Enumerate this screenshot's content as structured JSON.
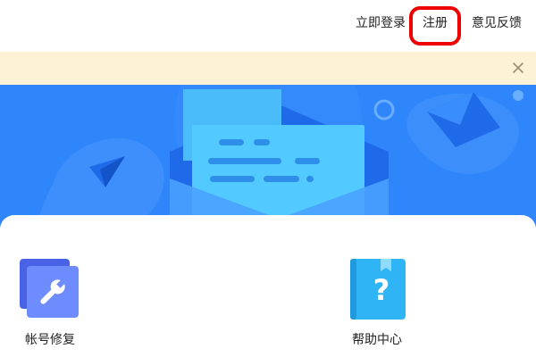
{
  "topbar": {
    "login_label": "立即登录",
    "register_label": "注册",
    "feedback_label": "意见反馈"
  },
  "notice": {
    "close_icon": "close-icon"
  },
  "banner": {
    "illustration": "mail-envelope-illustration"
  },
  "entries": [
    {
      "label": "帐号修复",
      "icon": "wrench-icon"
    },
    {
      "label": "帮助中心",
      "icon": "question-book-icon"
    }
  ],
  "colors": {
    "banner_blue": "#2f86fb",
    "highlight_red": "#ee0000",
    "notice_bg": "#fdf1d6",
    "text": "#222222"
  }
}
